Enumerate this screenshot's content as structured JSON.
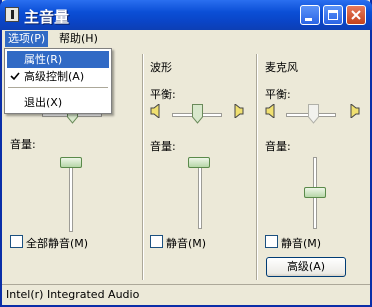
{
  "window": {
    "title": "主音量"
  },
  "menubar": {
    "options": "选项(P)",
    "help": "帮助(H)"
  },
  "options_menu": {
    "items": [
      {
        "label": "属性(R)",
        "checked": false,
        "highlighted": true
      },
      {
        "label": "高级控制(A)",
        "checked": true,
        "highlighted": false
      },
      {
        "label": "退出(X)",
        "checked": false,
        "highlighted": false
      }
    ]
  },
  "columns": [
    {
      "title": "",
      "balance_label": "",
      "volume_label": "音量:",
      "mute_label": "全部静音(M)",
      "volume_level": 0.8,
      "balance": 0.5
    },
    {
      "title": "波形",
      "balance_label": "平衡:",
      "volume_label": "音量:",
      "mute_label": "静音(M)",
      "volume_level": 0.8,
      "balance": 0.5
    },
    {
      "title": "麦克风",
      "balance_label": "平衡:",
      "volume_label": "音量:",
      "mute_label": "静音(M)",
      "volume_level": 0.35,
      "balance": 0.5,
      "advanced_label": "高级(A)"
    }
  ],
  "status_bar": {
    "text": "Intel(r) Integrated Audio"
  }
}
